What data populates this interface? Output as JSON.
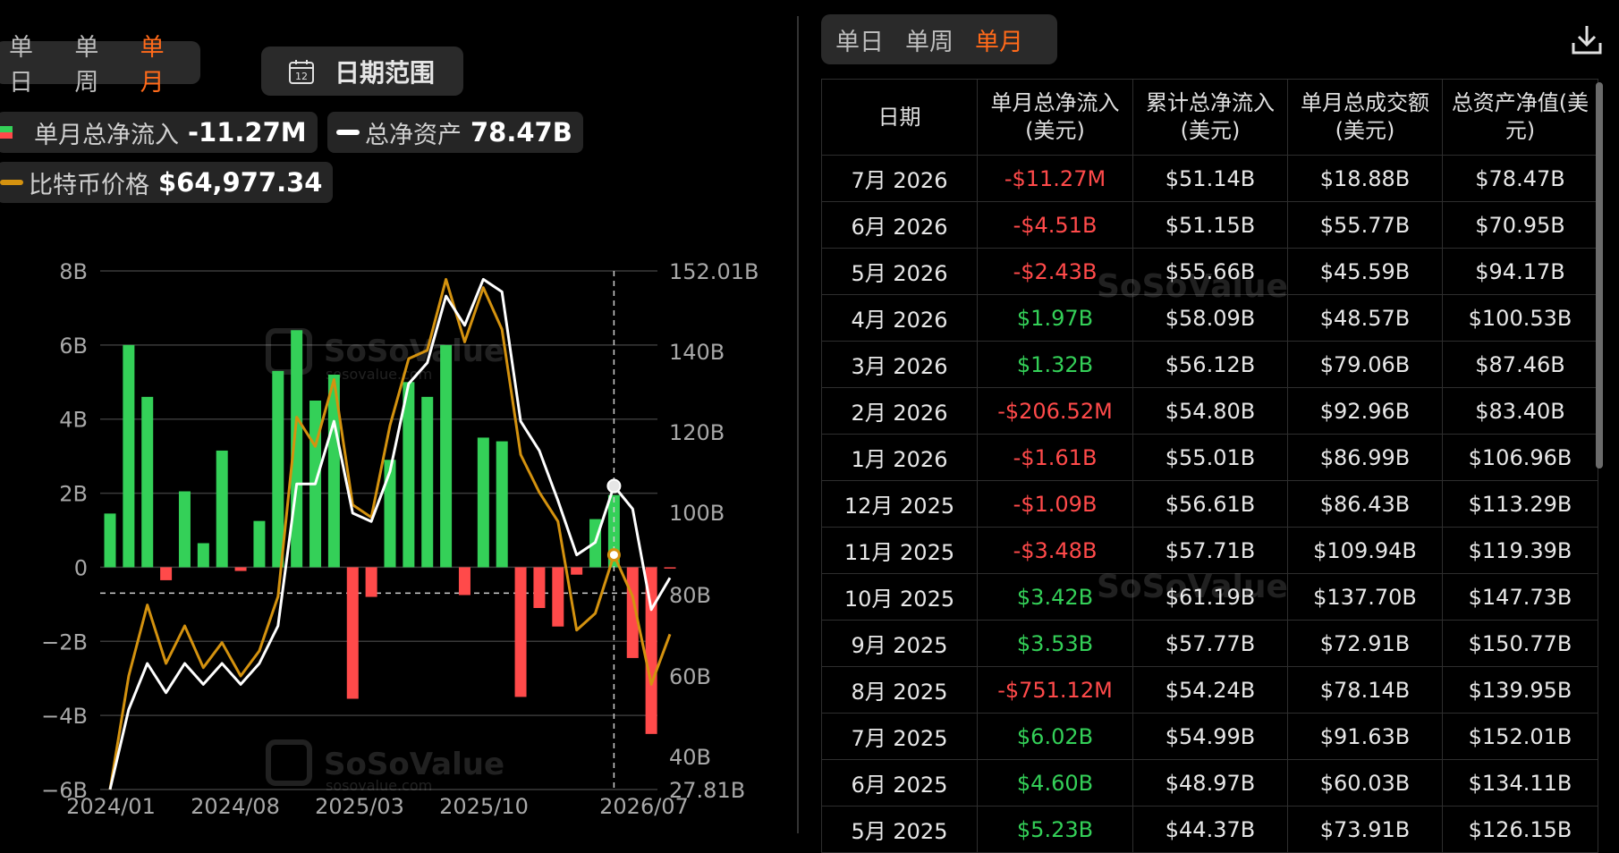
{
  "left_panel": {
    "tabs": [
      "单日",
      "单周",
      "单月"
    ],
    "active_tab": "单月",
    "date_range_label": "日期范围",
    "date_range_icon": "calendar-icon",
    "calendar_day": "12",
    "legend": {
      "net_inflow_label": "单月总净流入",
      "net_inflow_value": "-11.27M",
      "net_assets_label": "总净资产",
      "net_assets_value": "78.47B",
      "btc_price_label": "比特币价格",
      "btc_price_value": "$64,977.34"
    }
  },
  "right_panel": {
    "tabs": [
      "单日",
      "单周",
      "单月"
    ],
    "active_tab": "单月",
    "download_icon": "download-icon",
    "table": {
      "headers": [
        "日期",
        "单月总净流入\n(美元)",
        "累计总净流入\n(美元)",
        "单月总成交额\n(美元)",
        "总资产净值(美\n元)"
      ],
      "rows": [
        [
          "7月 2026",
          "-$11.27M",
          "$51.14B",
          "$18.88B",
          "$78.47B"
        ],
        [
          "6月 2026",
          "-$4.51B",
          "$51.15B",
          "$55.77B",
          "$70.95B"
        ],
        [
          "5月 2026",
          "-$2.43B",
          "$55.66B",
          "$45.59B",
          "$94.17B"
        ],
        [
          "4月 2026",
          "$1.97B",
          "$58.09B",
          "$48.57B",
          "$100.53B"
        ],
        [
          "3月 2026",
          "$1.32B",
          "$56.12B",
          "$79.06B",
          "$87.46B"
        ],
        [
          "2月 2026",
          "-$206.52M",
          "$54.80B",
          "$92.96B",
          "$83.40B"
        ],
        [
          "1月 2026",
          "-$1.61B",
          "$55.01B",
          "$86.99B",
          "$106.96B"
        ],
        [
          "12月 2025",
          "-$1.09B",
          "$56.61B",
          "$86.43B",
          "$113.29B"
        ],
        [
          "11月 2025",
          "-$3.48B",
          "$57.71B",
          "$109.94B",
          "$119.39B"
        ],
        [
          "10月 2025",
          "$3.42B",
          "$61.19B",
          "$137.70B",
          "$147.73B"
        ],
        [
          "9月 2025",
          "$3.53B",
          "$57.77B",
          "$72.91B",
          "$150.77B"
        ],
        [
          "8月 2025",
          "-$751.12M",
          "$54.24B",
          "$78.14B",
          "$139.95B"
        ],
        [
          "7月 2025",
          "$6.02B",
          "$54.99B",
          "$91.63B",
          "$152.01B"
        ],
        [
          "6月 2025",
          "$4.60B",
          "$48.97B",
          "$60.03B",
          "$134.11B"
        ],
        [
          "5月 2025",
          "$5.23B",
          "$44.37B",
          "$73.91B",
          "$126.15B"
        ]
      ]
    }
  },
  "watermark": {
    "brand": "SoSoValue",
    "url": "sosovalue.com"
  },
  "colors": {
    "accent": "#ff6a1a",
    "positive": "#34d058",
    "negative": "#ff4a4a",
    "btc_line": "#d4920f",
    "assets_line": "#ffffff",
    "panel_bg": "#2a2a2a"
  },
  "chart_data": {
    "type": "bar",
    "title": "",
    "x_tick_labels": [
      "2024/01",
      "2024/08",
      "2025/03",
      "2025/10",
      "2026/07"
    ],
    "y_left_ticks": [
      "8B",
      "6B",
      "4B",
      "2B",
      "0",
      "−2B",
      "−4B",
      "−6B"
    ],
    "y_right_ticks": [
      "152.01B",
      "140B",
      "120B",
      "100B",
      "80B",
      "60B",
      "40B",
      "27.81B"
    ],
    "y_left_range": [
      -6,
      8
    ],
    "y_right_range": [
      27.81,
      152.01
    ],
    "grid": true,
    "reference_line_y_left": -0.7,
    "hover_index": 27,
    "series": [
      {
        "name": "单月总净流入",
        "type": "bar",
        "axis": "left",
        "values": [
          1.45,
          6.0,
          4.6,
          -0.35,
          2.05,
          0.65,
          3.15,
          -0.1,
          1.25,
          5.3,
          6.4,
          4.5,
          5.2,
          -3.55,
          -0.8,
          2.9,
          5.0,
          4.6,
          6.0,
          -0.75,
          3.5,
          3.4,
          -3.5,
          -1.1,
          -1.6,
          -0.2,
          1.3,
          1.95,
          -2.45,
          -4.5,
          -0.01
        ]
      },
      {
        "name": "总净资产",
        "type": "line",
        "axis": "right",
        "values": [
          27.81,
          47,
          58,
          51,
          58,
          53,
          58,
          53,
          58,
          67,
          101,
          101,
          116,
          94,
          92,
          104,
          125,
          130,
          146,
          139,
          150,
          147,
          116,
          109,
          97,
          84,
          87,
          100.5,
          95,
          70.9,
          78.5
        ]
      },
      {
        "name": "比特币价格",
        "type": "line",
        "axis": "right",
        "values": [
          27.81,
          55,
          72,
          58,
          67,
          57,
          63,
          55,
          61,
          74,
          117,
          110,
          126,
          96,
          93,
          115,
          131,
          133,
          150,
          135,
          148,
          138,
          108,
          99,
          92,
          66,
          70,
          84,
          74,
          53,
          65
        ]
      }
    ]
  }
}
